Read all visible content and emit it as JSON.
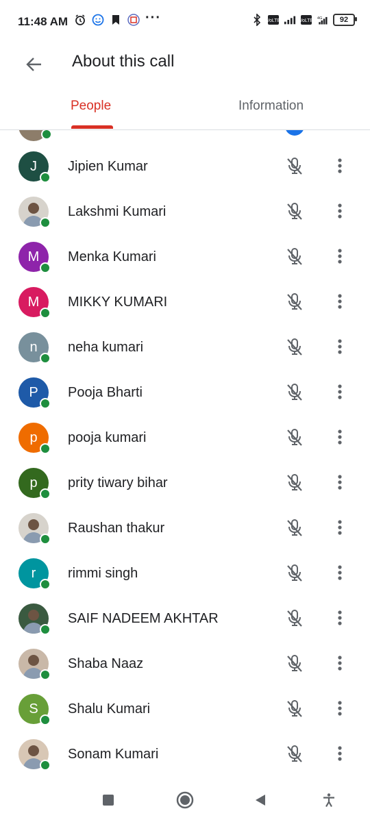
{
  "status_bar": {
    "time": "11:48 AM",
    "battery": "92",
    "icons_left": [
      "alarm-icon",
      "emoji-icon",
      "bookmark-icon",
      "app-icon",
      "more-dots-icon"
    ],
    "icons_right": [
      "bluetooth-icon",
      "volte-icon",
      "signal-icon",
      "volte-icon",
      "signal-4g-icon",
      "battery-icon"
    ]
  },
  "app_bar": {
    "title": "About this call"
  },
  "tabs": [
    {
      "label": "People",
      "selected": true
    },
    {
      "label": "Information",
      "selected": false
    }
  ],
  "colors": {
    "accent": "#d93025",
    "online": "#1e8e3e",
    "icon_gray": "#5f6368"
  },
  "participants": [
    {
      "name": "Jipien Kumar",
      "initial": "J",
      "avatar_color": "#1e4f43",
      "photo": false,
      "muted": true
    },
    {
      "name": "Lakshmi Kumari",
      "initial": "",
      "avatar_color": "#d7d3cc",
      "photo": true,
      "muted": true
    },
    {
      "name": "Menka Kumari",
      "initial": "M",
      "avatar_color": "#8e24aa",
      "photo": false,
      "muted": true
    },
    {
      "name": "MIKKY KUMARI",
      "initial": "M",
      "avatar_color": "#d81b60",
      "photo": false,
      "muted": true
    },
    {
      "name": "neha kumari",
      "initial": "n",
      "avatar_color": "#78909c",
      "photo": false,
      "muted": true
    },
    {
      "name": "Pooja Bharti",
      "initial": "P",
      "avatar_color": "#1e5aa8",
      "photo": false,
      "muted": true
    },
    {
      "name": "pooja kumari",
      "initial": "p",
      "avatar_color": "#ef6c00",
      "photo": false,
      "muted": true
    },
    {
      "name": "prity tiwary bihar",
      "initial": "p",
      "avatar_color": "#33691e",
      "photo": false,
      "muted": true
    },
    {
      "name": "Raushan thakur",
      "initial": "",
      "avatar_color": "#d7d3cc",
      "photo": true,
      "muted": true
    },
    {
      "name": "rimmi singh",
      "initial": "r",
      "avatar_color": "#00959f",
      "photo": false,
      "muted": true
    },
    {
      "name": "SAIF NADEEM AKHTAR",
      "initial": "",
      "avatar_color": "#3a5a40",
      "photo": true,
      "muted": true
    },
    {
      "name": "Shaba Naaz",
      "initial": "",
      "avatar_color": "#c9b8a8",
      "photo": true,
      "muted": true
    },
    {
      "name": "Shalu Kumari",
      "initial": "S",
      "avatar_color": "#689f38",
      "photo": false,
      "muted": true
    },
    {
      "name": "Sonam Kumari",
      "initial": "",
      "avatar_color": "#d8c7b5",
      "photo": true,
      "muted": true
    }
  ],
  "nav_bar": {
    "buttons": [
      "recents-square-icon",
      "home-circle-icon",
      "back-triangle-icon",
      "accessibility-icon"
    ]
  }
}
